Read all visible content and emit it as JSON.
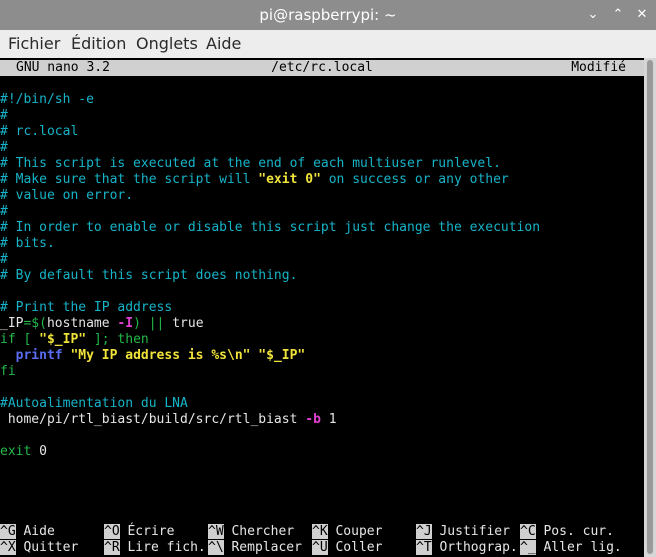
{
  "window": {
    "title": "pi@raspberrypi: ~",
    "minimize_glyph": "⌄",
    "maximize_glyph": "⌃",
    "close_glyph": "✕"
  },
  "menu": [
    "Fichier",
    "Édition",
    "Onglets",
    "Aide"
  ],
  "nano_header": {
    "version": "GNU nano 3.2",
    "filename": "/etc/rc.local",
    "status": "Modifié"
  },
  "lines": [
    [
      {
        "t": "#!/bin/sh -e",
        "c": "comment"
      }
    ],
    [
      {
        "t": "#",
        "c": "comment"
      }
    ],
    [
      {
        "t": "# rc.local",
        "c": "comment"
      }
    ],
    [
      {
        "t": "#",
        "c": "comment"
      }
    ],
    [
      {
        "t": "# This script is executed at the end of each multiuser runlevel.",
        "c": "comment"
      }
    ],
    [
      {
        "t": "# Make sure that the script will ",
        "c": "comment"
      },
      {
        "t": "\"exit 0\"",
        "c": "yellow"
      },
      {
        "t": " on success or any other",
        "c": "comment"
      }
    ],
    [
      {
        "t": "# value on error.",
        "c": "comment"
      }
    ],
    [
      {
        "t": "#",
        "c": "comment"
      }
    ],
    [
      {
        "t": "# In order to enable or disable this script just change the execution",
        "c": "comment"
      }
    ],
    [
      {
        "t": "# bits.",
        "c": "comment"
      }
    ],
    [
      {
        "t": "#",
        "c": "comment"
      }
    ],
    [
      {
        "t": "# By default this script does nothing.",
        "c": "comment"
      }
    ],
    [],
    [
      {
        "t": "# Print the IP address",
        "c": "comment"
      }
    ],
    [
      {
        "t": "_IP",
        "c": "white"
      },
      {
        "t": "=$(",
        "c": "green"
      },
      {
        "t": "hostname ",
        "c": "white"
      },
      {
        "t": "-I",
        "c": "magenta"
      },
      {
        "t": ")",
        "c": "green"
      },
      {
        "t": " || ",
        "c": "green"
      },
      {
        "t": "true",
        "c": "white"
      }
    ],
    [
      {
        "t": "if",
        "c": "green"
      },
      {
        "t": " [ ",
        "c": "green"
      },
      {
        "t": "\"$_IP\"",
        "c": "yellow"
      },
      {
        "t": " ]; ",
        "c": "green"
      },
      {
        "t": "then",
        "c": "green"
      }
    ],
    [
      {
        "t": "  ",
        "c": "white"
      },
      {
        "t": "printf",
        "c": "blue"
      },
      {
        "t": " ",
        "c": "white"
      },
      {
        "t": "\"My IP address is %s\\n\"",
        "c": "yellow"
      },
      {
        "t": " ",
        "c": "white"
      },
      {
        "t": "\"$_IP\"",
        "c": "yellow"
      }
    ],
    [
      {
        "t": "fi",
        "c": "green"
      }
    ],
    [],
    [
      {
        "t": "#Autoalimentation du LNA",
        "c": "comment"
      }
    ],
    [
      {
        "t": "/",
        "c": "cursor"
      },
      {
        "t": "home/pi/rtl_biast/build/src/rtl_biast ",
        "c": "white"
      },
      {
        "t": "-b",
        "c": "magenta"
      },
      {
        "t": " 1",
        "c": "white"
      }
    ],
    [],
    [
      {
        "t": "exit",
        "c": "green"
      },
      {
        "t": " 0",
        "c": "white"
      }
    ]
  ],
  "shortcuts": [
    [
      {
        "key": "^G",
        "label": "Aide"
      },
      {
        "key": "^O",
        "label": "Écrire"
      },
      {
        "key": "^W",
        "label": "Chercher"
      },
      {
        "key": "^K",
        "label": "Couper"
      },
      {
        "key": "^J",
        "label": "Justifier"
      },
      {
        "key": "^C",
        "label": "Pos. cur."
      }
    ],
    [
      {
        "key": "^X",
        "label": "Quitter"
      },
      {
        "key": "^R",
        "label": "Lire fich."
      },
      {
        "key": "^\\",
        "label": "Remplacer"
      },
      {
        "key": "^U",
        "label": "Coller"
      },
      {
        "key": "^T",
        "label": "Orthograp."
      },
      {
        "key": "^_",
        "label": "Aller lig."
      }
    ]
  ]
}
